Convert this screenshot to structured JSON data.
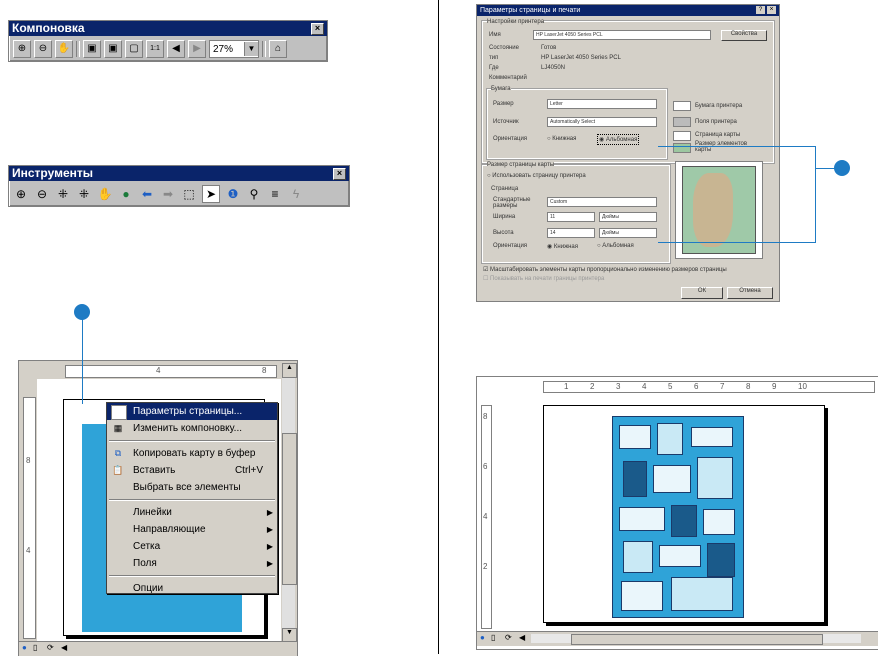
{
  "layout_toolbar": {
    "title": "Компоновка",
    "zoom_value": "27%"
  },
  "tools_toolbar": {
    "title": "Инструменты"
  },
  "close_glyph": "×",
  "layout_window": {
    "ruler_labels": [
      "4",
      "8"
    ],
    "vruler_labels": [
      "8",
      "4"
    ],
    "context_menu": [
      {
        "label": "Параметры страницы...",
        "icon": "page-setup-icon",
        "selected": true
      },
      {
        "label": "Изменить компоновку...",
        "icon": "change-layout-icon"
      },
      {
        "sep": true
      },
      {
        "label": "Копировать карту в буфер",
        "icon": "copy-map-icon"
      },
      {
        "label": "Вставить",
        "icon": "paste-icon",
        "shortcut": "Ctrl+V"
      },
      {
        "label": "Выбрать все элементы"
      },
      {
        "sep": true
      },
      {
        "label": "Линейки",
        "submenu": true
      },
      {
        "label": "Направляющие",
        "submenu": true
      },
      {
        "label": "Сетка",
        "submenu": true
      },
      {
        "label": "Поля",
        "submenu": true
      },
      {
        "sep": true
      },
      {
        "label": "Опции"
      }
    ]
  },
  "page_setup_dialog": {
    "title": "Параметры страницы и печати",
    "printer_section": "Настройки принтера",
    "name_label": "Имя",
    "name_value": "HP LaserJet 4050 Series PCL",
    "properties_button": "Свойства",
    "status_label": "Состояние",
    "status_value": "Готов",
    "type_label": "тип",
    "type_value": "HP LaserJet 4050 Series PCL",
    "where_label": "Где",
    "where_value": "LJ4050N",
    "comment_label": "Комментарий",
    "paper_section": "Бумага",
    "size_label": "Размер",
    "size_value": "Letter",
    "source_label": "Источник",
    "source_value": "Automatically Select",
    "orientation_label": "Ориентация",
    "portrait": "Книжная",
    "landscape": "Альбомная",
    "legend_printer_paper": "Бумага принтера",
    "legend_printer_margins": "Поля принтера",
    "legend_map_page": "Страница карты",
    "legend_map_size": "Размер элементов карты",
    "map_page_section": "Размер страницы карты",
    "use_printer_page": "Использовать страницу принтера",
    "page_section": "Страница",
    "standard_sizes_label": "Стандартные размеры",
    "standard_sizes_value": "Custom",
    "width_label": "Ширина",
    "width_value": "11",
    "height_label": "Высота",
    "height_value": "14",
    "units_value": "Дюймы",
    "orientation2_label": "Ориентация",
    "scale_checkbox": "Масштабировать элементы карты пропорционально изменению размеров страницы",
    "disabled_checkbox": "Показывать на печати границы принтера",
    "ok_button": "ОК",
    "cancel_button": "Отмена"
  },
  "preview_window": {
    "ruler_labels": [
      "1",
      "2",
      "3",
      "4",
      "5",
      "6",
      "7",
      "8",
      "9",
      "10"
    ],
    "vruler_labels": [
      "8",
      "6",
      "4",
      "2"
    ]
  },
  "colors": {
    "callout": "#1e7bc4",
    "title_bar": "#0a246a",
    "map_cyan": "#2fa3d8"
  }
}
